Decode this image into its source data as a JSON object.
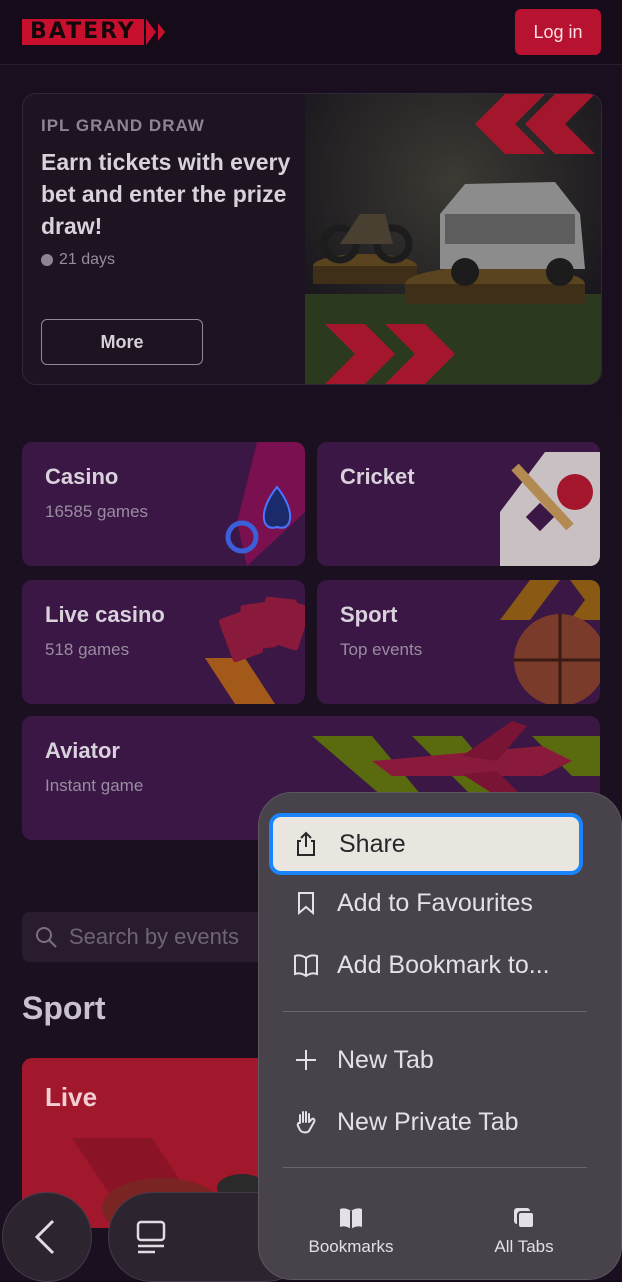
{
  "header": {
    "logo": "BATERY",
    "login_label": "Log in"
  },
  "promo": {
    "kicker": "IPL GRAND DRAW",
    "title": "Earn tickets with every bet and enter the prize draw!",
    "time_left": "21 days",
    "more_label": "More"
  },
  "categories": [
    {
      "title": "Casino",
      "subtitle": "16585 games"
    },
    {
      "title": "Cricket",
      "subtitle": ""
    },
    {
      "title": "Live casino",
      "subtitle": "518 games"
    },
    {
      "title": "Sport",
      "subtitle": "Top events"
    },
    {
      "title": "Aviator",
      "subtitle": "Instant game"
    }
  ],
  "sport": {
    "search_placeholder": "Search by events",
    "heading": "Sport",
    "live_label": "Live"
  },
  "menu": {
    "items": [
      {
        "label": "Share",
        "icon": "share-icon",
        "selected": true
      },
      {
        "label": "Add to Favourites",
        "icon": "bookmark-icon"
      },
      {
        "label": "Add Bookmark to...",
        "icon": "book-icon"
      },
      {
        "label": "New Tab",
        "icon": "plus-icon"
      },
      {
        "label": "New Private Tab",
        "icon": "hand-icon"
      }
    ],
    "bottom": [
      {
        "label": "Bookmarks",
        "icon": "book-icon"
      },
      {
        "label": "All Tabs",
        "icon": "tabs-icon"
      }
    ]
  },
  "colors": {
    "brand": "#c8102e",
    "selection_border": "#1a84ff",
    "tile": "#3a1744"
  }
}
